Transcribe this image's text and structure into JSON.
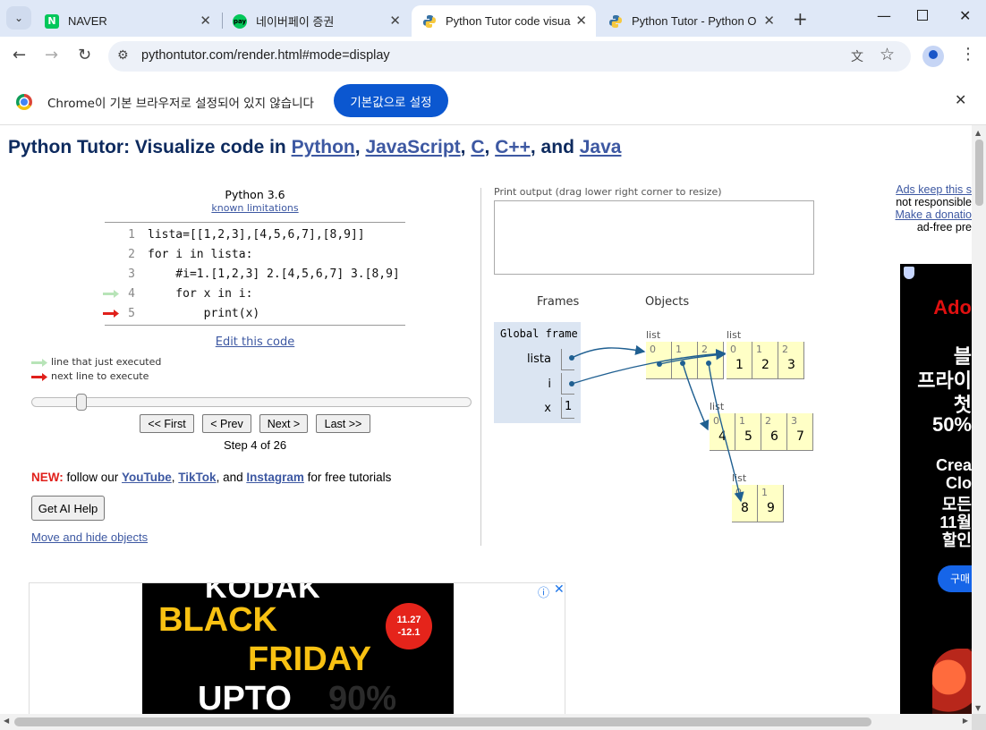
{
  "browser": {
    "tabs": [
      {
        "title": "NAVER",
        "icon": "naver-icon"
      },
      {
        "title": "네이버페이 증권",
        "icon": "naverpay-icon"
      },
      {
        "title": "Python Tutor code visuali",
        "icon": "python-icon",
        "active": true
      },
      {
        "title": "Python Tutor - Python On",
        "icon": "python-icon"
      }
    ],
    "url": "pythontutor.com/render.html#mode=display",
    "infobar": {
      "text": "Chrome이 기본 브라우저로 설정되어 있지 않습니다",
      "button": "기본값으로 설정"
    }
  },
  "header": {
    "prefix": "Python Tutor: Visualize code in ",
    "python": "Python",
    "sep1": ", ",
    "javascript": "JavaScript",
    "sep2": ", ",
    "c": "C",
    "sep3": ", ",
    "cpp": "C++",
    "sep4": ", and ",
    "java": "Java"
  },
  "editor": {
    "language": "Python 3.6",
    "limitations_link": "known limitations",
    "lines": [
      {
        "num": "1",
        "code": "lista=[[1,2,3],[4,5,6,7],[8,9]]"
      },
      {
        "num": "2",
        "code": "for i in lista:"
      },
      {
        "num": "3",
        "code": "    #i=1.[1,2,3] 2.[4,5,6,7] 3.[8,9]"
      },
      {
        "num": "4",
        "code": "    for x in i:"
      },
      {
        "num": "5",
        "code": "        print(x)"
      }
    ],
    "just_executed_line": 4,
    "next_line": 5,
    "edit_link": "Edit this code"
  },
  "legend": {
    "executed": "line that just executed",
    "next": "next line to execute"
  },
  "controls": {
    "first": "<< First",
    "prev": "< Prev",
    "next": "Next >",
    "last": "Last >>",
    "step_text": "Step 4 of 26",
    "step": 4,
    "total": 26
  },
  "promo": {
    "new": "NEW:",
    "follow": " follow our ",
    "youtube": "YouTube",
    "c1": ", ",
    "tiktok": "TikTok",
    "c2": ", and ",
    "instagram": "Instagram",
    "tail": " for free tutorials"
  },
  "ai_help": "Get AI Help",
  "move_hide": "Move and hide objects",
  "print_output": {
    "label": "Print output (drag lower right corner to resize)",
    "content": ""
  },
  "viz": {
    "frames_label": "Frames",
    "objects_label": "Objects",
    "frame_name": "Global frame",
    "vars": [
      {
        "name": "lista",
        "value": ""
      },
      {
        "name": "i",
        "value": ""
      },
      {
        "name": "x",
        "value": "1"
      }
    ],
    "heap": [
      {
        "type": "list",
        "items": [
          {
            "idx": "0",
            "val": ""
          },
          {
            "idx": "1",
            "val": ""
          },
          {
            "idx": "2",
            "val": ""
          }
        ]
      },
      {
        "type": "list",
        "items": [
          {
            "idx": "0",
            "val": "1"
          },
          {
            "idx": "1",
            "val": "2"
          },
          {
            "idx": "2",
            "val": "3"
          }
        ]
      },
      {
        "type": "list",
        "items": [
          {
            "idx": "0",
            "val": "4"
          },
          {
            "idx": "1",
            "val": "5"
          },
          {
            "idx": "2",
            "val": "6"
          },
          {
            "idx": "3",
            "val": "7"
          }
        ]
      },
      {
        "type": "list",
        "items": [
          {
            "idx": "0",
            "val": "8"
          },
          {
            "idx": "1",
            "val": "9"
          }
        ]
      }
    ]
  },
  "ads": {
    "side_links": {
      "keep": "Ads keep this s",
      "not_responsible": "not responsible",
      "donation": "Make a donatio",
      "adfree": "ad-free pre"
    },
    "side_banner": [
      "Ado",
      "블",
      "프라이",
      "첫",
      "50%",
      "Crea",
      "Clo",
      "모든",
      "11월",
      "할인",
      "구매"
    ],
    "kodak": {
      "line1": "KODAK",
      "line2": "BLACK",
      "line3": "FRIDAY",
      "line4": "UPTO",
      "line4b": "90%",
      "badge1": "11.27",
      "badge2": "-12.1"
    }
  },
  "colors": {
    "link": "#3d58a2",
    "title": "#0d2a5e",
    "executed_arrow": "#b8e4b8",
    "next_arrow": "#e0201b",
    "heap_cell": "#ffffc6",
    "frame_bg": "#dbe5f2",
    "ptr": "#1f5f91"
  }
}
